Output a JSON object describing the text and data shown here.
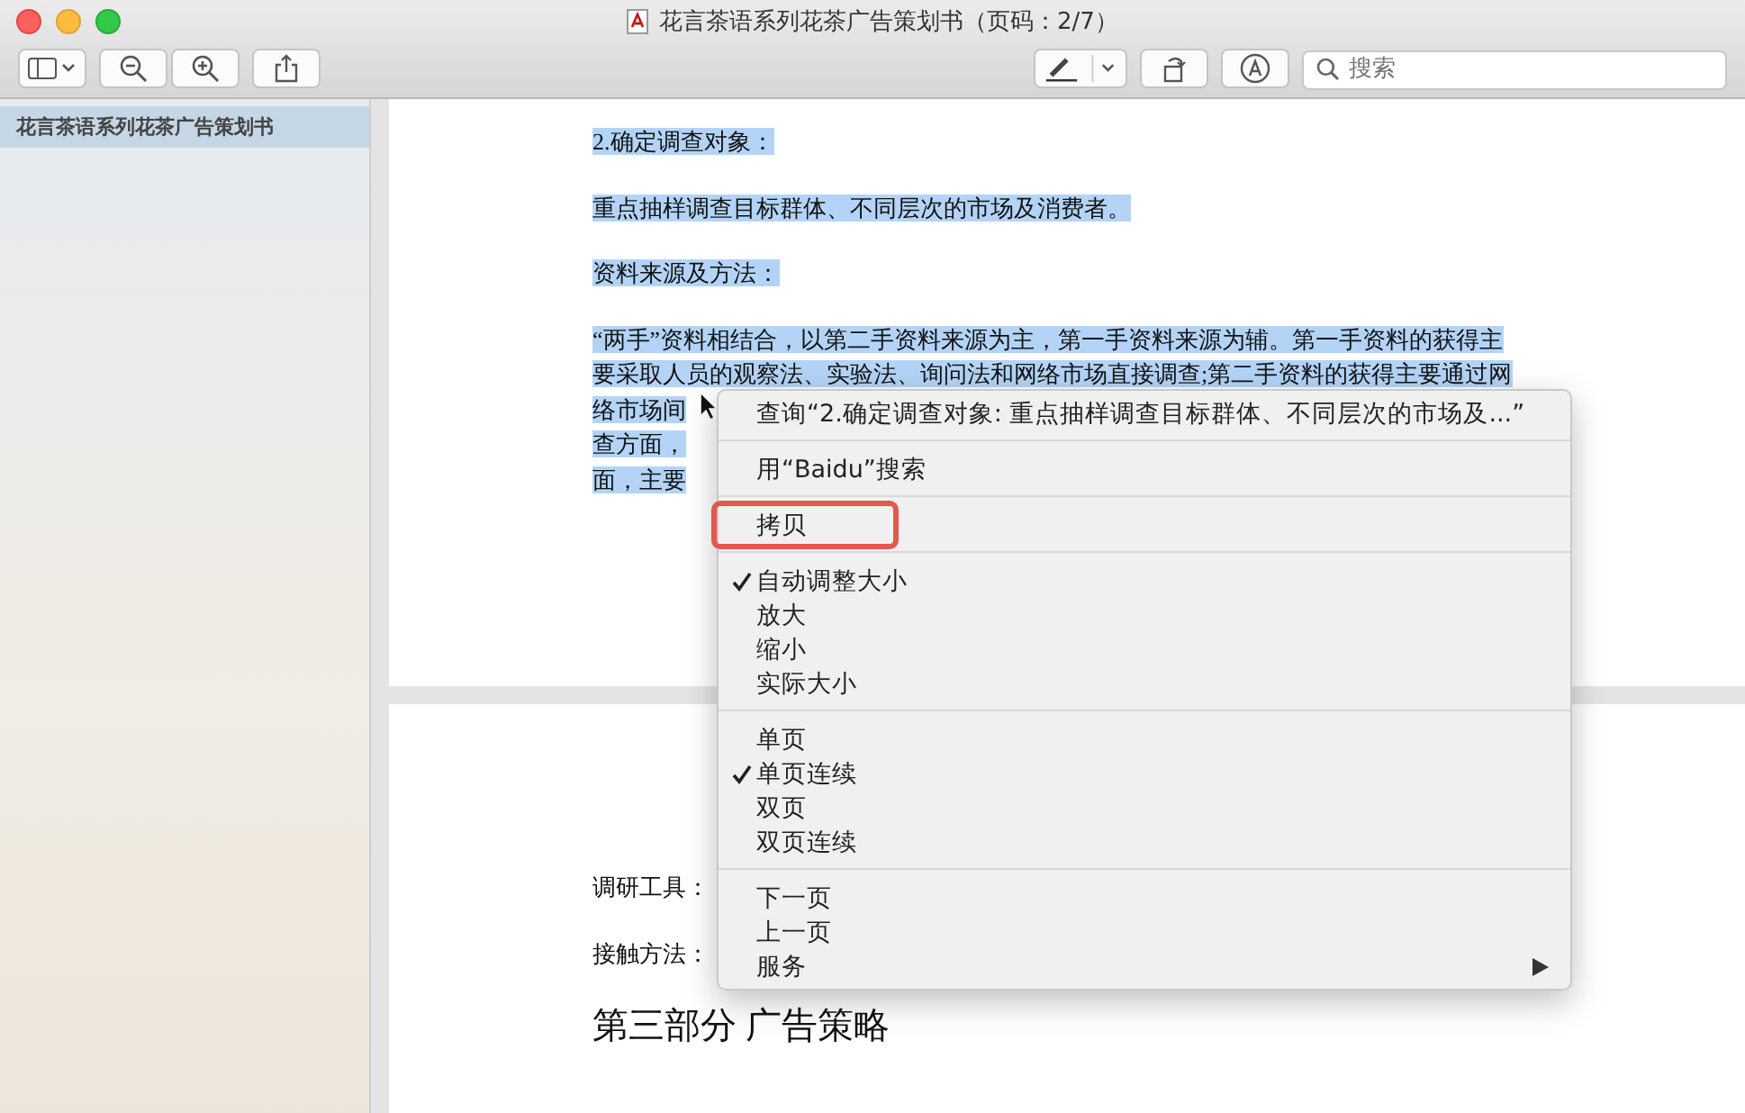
{
  "window": {
    "title": "花言茶语系列花茶广告策划书（页码：2/7）"
  },
  "toolbar": {
    "search": {
      "placeholder": "搜索"
    }
  },
  "sidebar": {
    "items": [
      {
        "label": "花言茶语系列花茶广告策划书",
        "selected": true
      }
    ]
  },
  "pages": [
    {
      "paragraphs": [
        {
          "kind": "text",
          "selected": true,
          "lines": [
            "2.确定调查对象："
          ]
        },
        {
          "kind": "text",
          "selected": true,
          "lines": [
            "重点抽样调查目标群体、不同层次的市场及消费者。"
          ]
        },
        {
          "kind": "text",
          "selected": true,
          "lines": [
            "资料来源及方法："
          ]
        },
        {
          "kind": "text",
          "selected": true,
          "lines": [
            "“两手”资料相结合，以第二手资料来源为主，第一手资料来源为辅。第一手资料的获得主",
            "要采取人员的观察法、实验法、询问法和网络市场直接调查;第二手资料的获得主要通过网",
            "络市场间",
            "查方面，",
            "面，主要"
          ]
        }
      ]
    },
    {
      "paragraphs": [
        {
          "kind": "text",
          "selected": false,
          "lines": [
            "调研工具："
          ]
        },
        {
          "kind": "text",
          "selected": false,
          "lines": [
            "接触方法："
          ]
        },
        {
          "kind": "heading",
          "selected": false,
          "lines": [
            "第三部分  广告策略"
          ]
        }
      ]
    }
  ],
  "context_menu": {
    "groups": [
      [
        {
          "label": "查询“2.确定调查对象: 重点抽样调查目标群体、不同层次的市场及...”",
          "checked": false,
          "submenu": false,
          "annotated": false
        }
      ],
      [
        {
          "label": "用“Baidu”搜索",
          "checked": false,
          "submenu": false,
          "annotated": false
        }
      ],
      [
        {
          "label": "拷贝",
          "checked": false,
          "submenu": false,
          "annotated": true
        }
      ],
      [
        {
          "label": "自动调整大小",
          "checked": true,
          "submenu": false,
          "annotated": false
        },
        {
          "label": "放大",
          "checked": false,
          "submenu": false,
          "annotated": false
        },
        {
          "label": "缩小",
          "checked": false,
          "submenu": false,
          "annotated": false
        },
        {
          "label": "实际大小",
          "checked": false,
          "submenu": false,
          "annotated": false
        }
      ],
      [
        {
          "label": "单页",
          "checked": false,
          "submenu": false,
          "annotated": false
        },
        {
          "label": "单页连续",
          "checked": true,
          "submenu": false,
          "annotated": false
        },
        {
          "label": "双页",
          "checked": false,
          "submenu": false,
          "annotated": false
        },
        {
          "label": "双页连续",
          "checked": false,
          "submenu": false,
          "annotated": false
        }
      ],
      [
        {
          "label": "下一页",
          "checked": false,
          "submenu": false,
          "annotated": false
        },
        {
          "label": "上一页",
          "checked": false,
          "submenu": false,
          "annotated": false
        },
        {
          "label": "服务",
          "checked": false,
          "submenu": true,
          "annotated": false
        }
      ]
    ]
  }
}
